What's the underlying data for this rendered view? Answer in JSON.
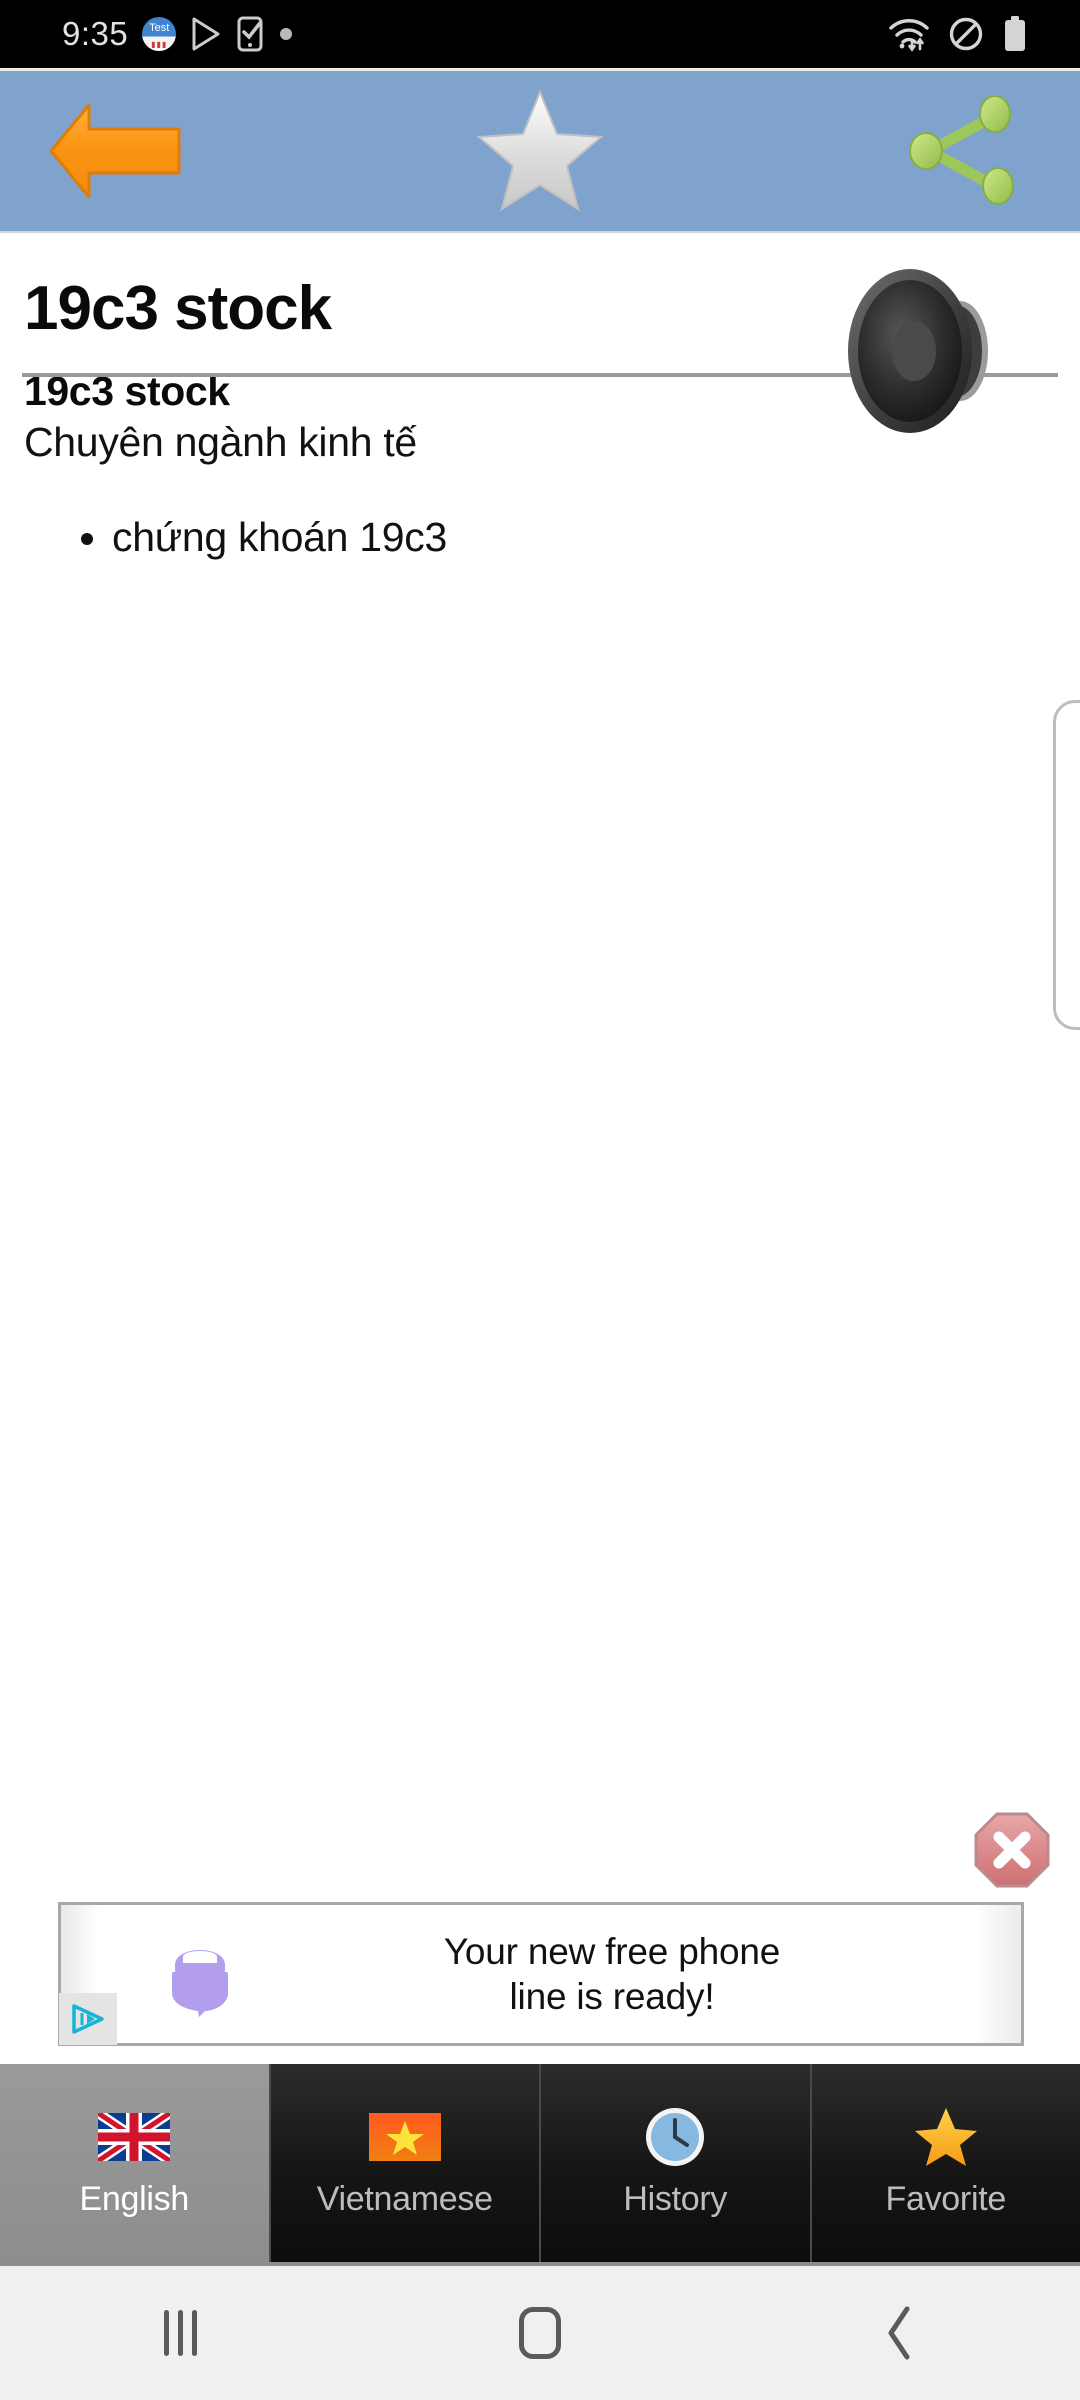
{
  "statusbar": {
    "time": "9:35",
    "left_icons": [
      {
        "name": "test-app-icon",
        "label": "Test"
      },
      {
        "name": "play-store-icon",
        "label": ""
      },
      {
        "name": "phone-check-icon",
        "label": ""
      },
      {
        "name": "dot-indicator-icon",
        "label": ""
      }
    ],
    "right_icons": [
      {
        "name": "wifi-icon",
        "label": ""
      },
      {
        "name": "do-not-disturb-icon",
        "label": ""
      },
      {
        "name": "battery-icon",
        "label": ""
      }
    ]
  },
  "toolbar": {
    "back_icon": "back-arrow-icon",
    "favorite_icon": "star-icon",
    "share_icon": "share-icon",
    "background_color": "#7fa3cd"
  },
  "content": {
    "title": "19c3 stock",
    "speaker_icon": "speaker-icon",
    "entry_headword": "19c3 stock",
    "entry_category": "Chuyên ngành kinh tế",
    "definitions": [
      "chứng khoán 19c3"
    ]
  },
  "ad": {
    "close_icon": "close-octagon-icon",
    "bubble_icon": "chat-bubble-icon",
    "adchoices_icon": "adchoices-icon",
    "line1": "Your new free phone",
    "line2": "line is ready!"
  },
  "tabs": [
    {
      "label": "English",
      "icon": "uk-flag-icon",
      "selected": true
    },
    {
      "label": "Vietnamese",
      "icon": "vietnam-flag-icon",
      "selected": false
    },
    {
      "label": "History",
      "icon": "clock-icon",
      "selected": false
    },
    {
      "label": "Favorite",
      "icon": "star-filled-icon",
      "selected": false
    }
  ],
  "navbar": {
    "recents_icon": "recents-icon",
    "home_icon": "home-icon",
    "back_icon": "nav-back-icon"
  }
}
